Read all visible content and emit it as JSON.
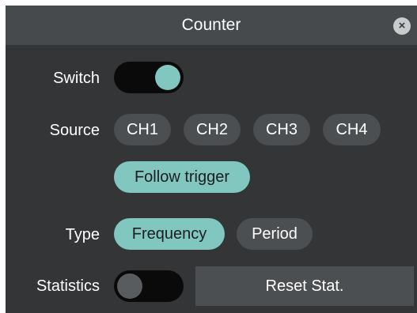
{
  "dialog": {
    "title": "Counter",
    "close_label": "×"
  },
  "switch": {
    "label": "Switch",
    "state": "on"
  },
  "source": {
    "label": "Source",
    "options": [
      "CH1",
      "CH2",
      "CH3",
      "CH4",
      "Follow trigger"
    ],
    "selected": "Follow trigger"
  },
  "type": {
    "label": "Type",
    "options": [
      "Frequency",
      "Period"
    ],
    "selected": "Frequency"
  },
  "statistics": {
    "label": "Statistics",
    "state": "off",
    "reset_label": "Reset Stat."
  },
  "colors": {
    "panel": "#333537",
    "titlebar": "#474a4d",
    "accent": "#82c6c0",
    "pill": "#4c4f52",
    "toggle_track": "#0a0a0a"
  },
  "icons": {
    "close": "close-icon"
  }
}
